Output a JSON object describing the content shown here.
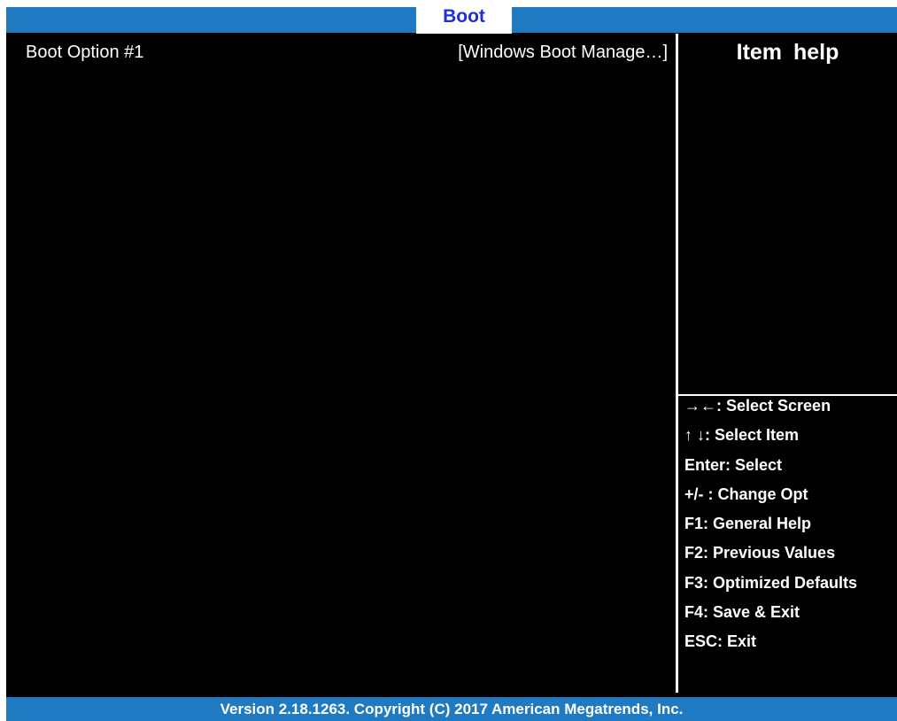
{
  "header": {
    "tab_label": "Boot"
  },
  "main": {
    "settings": [
      {
        "label": "Boot Option #1",
        "value": "[Windows Boot Manage…]"
      }
    ]
  },
  "help": {
    "title": "Item  help"
  },
  "key_legend": [
    "→←: Select Screen",
    "↑ ↓: Select Item",
    "Enter: Select",
    "+/- : Change Opt",
    "F1: General Help",
    "F2: Previous Values",
    "F3: Optimized Defaults",
    "F4: Save & Exit",
    "ESC: Exit"
  ],
  "footer": {
    "text": "Version 2.18.1263. Copyright (C) 2017 American Megatrends, Inc."
  },
  "colors": {
    "bar": "#1f7ac2",
    "background": "#000000",
    "active_tab_text": "#1f2fd8",
    "text": "#ffffff"
  }
}
